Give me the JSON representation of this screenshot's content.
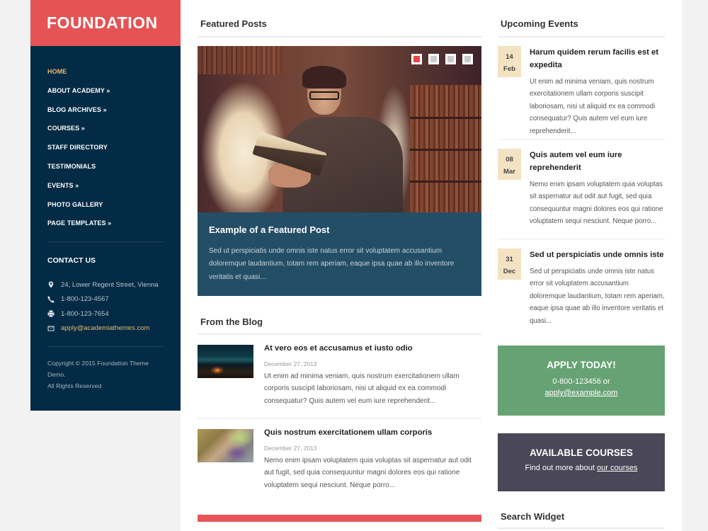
{
  "site": {
    "logo": "FOUNDATION"
  },
  "colors": {
    "brand_red": "#e55354",
    "sidebar_navy": "#042b45",
    "accent_gold": "#e8b96a",
    "caption_blue": "#244e66",
    "apply_green": "#67a274",
    "courses_slate": "#4a4858",
    "event_date_bg": "#f3e3c3"
  },
  "nav": {
    "items": [
      {
        "label": "HOME",
        "active": true
      },
      {
        "label": "ABOUT ACADEMY »"
      },
      {
        "label": "BLOG ARCHIVES »"
      },
      {
        "label": "COURSES »"
      },
      {
        "label": "STAFF DIRECTORY"
      },
      {
        "label": "TESTIMONIALS"
      },
      {
        "label": "EVENTS »"
      },
      {
        "label": "PHOTO GALLERY"
      },
      {
        "label": "PAGE TEMPLATES »"
      }
    ]
  },
  "contact": {
    "title": "CONTACT US",
    "address": {
      "icon": "map-marker-icon",
      "text": "24, Lower Regent Street, Vienna"
    },
    "phone": {
      "icon": "phone-icon",
      "text": "1-800-123-4567"
    },
    "fax": {
      "icon": "printer-icon",
      "text": "1-800-123-7654"
    },
    "email": {
      "icon": "envelope-icon",
      "text": "apply@academiathemes.com"
    }
  },
  "footer": {
    "copyright_line1": "Copyright © 2015 Foundation Theme Demo.",
    "copyright_line2": "All Rights Reserved"
  },
  "featured": {
    "title": "Featured Posts",
    "slide_count": 4,
    "active_slide": 1,
    "slide": {
      "title": "Example of a Featured Post",
      "excerpt": "Sed ut perspiciatis unde omnis iste natus error sit voluptatem accusantium doloremque laudantium, totam rem aperiam, eaque ipsa quae ab illo inventore veritatis et quasi..."
    }
  },
  "blog": {
    "title": "From the Blog",
    "posts": [
      {
        "title": "At vero eos et accusamus et iusto odio",
        "date": "December 27, 2013",
        "excerpt": "Ut enim ad minima veniam, quis nostrum exercitationem ullam corporis suscipit laboriosam, nisi ut aliquid ex ea commodi consequatur? Quis autem vel eum iure reprehenderit..."
      },
      {
        "title": "Quis nostrum exercitationem ullam corporis",
        "date": "December 27, 2013",
        "excerpt": "Nemo enim ipsam voluptatem quia voluptas sit aspernatur aut odit aut fugit, sed quia consequuntur magni dolores eos qui ratione voluptatem sequi nesciunt. Neque porro..."
      }
    ]
  },
  "events": {
    "title": "Upcoming Events",
    "items": [
      {
        "day": "14",
        "month": "Feb",
        "title": "Harum quidem rerum facilis est et expedita",
        "excerpt": "Ut enim ad minima veniam, quis nostrum exercitationem ullam corporis suscipit laboriosam, nisi ut aliquid ex ea commodi consequatur? Quis autem vel eum iure reprehenderit..."
      },
      {
        "day": "08",
        "month": "Mar",
        "title": "Quis autem vel eum iure reprehenderit",
        "excerpt": "Nemo enim ipsam voluptatem quia voluptas sit aspernatur aut odit aut fugit, sed quia consequuntur magni dolores eos qui ratione voluptatem sequi nesciunt. Neque porro..."
      },
      {
        "day": "31",
        "month": "Dec",
        "title": "Sed ut perspiciatis unde omnis iste",
        "excerpt": "Sed ut perspiciatis unde omnis iste natus error sit voluptatem accusantium doloremque laudantium, totam rem aperiam, eaque ipsa quae ab illo inventore veritatis et quasi..."
      }
    ]
  },
  "apply": {
    "title": "APPLY TODAY!",
    "phone_text": "0-800-123456 or",
    "email_link": "apply@example.com"
  },
  "courses": {
    "title": "AVAILABLE COURSES",
    "text": "Find out more about ",
    "link": "our courses"
  },
  "search_widget": {
    "title": "Search Widget"
  }
}
